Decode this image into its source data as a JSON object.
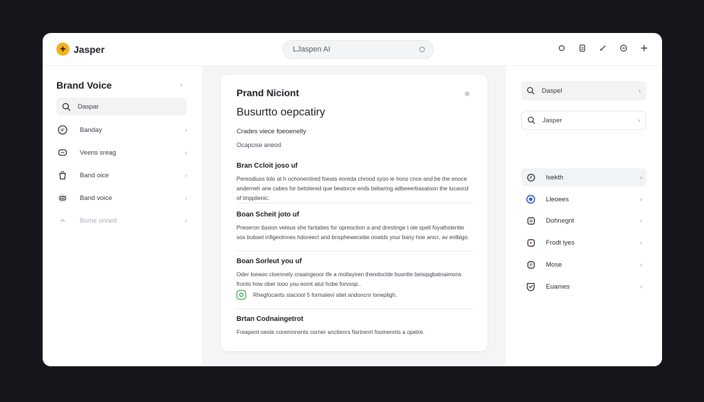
{
  "header": {
    "logo_text": "Jasper",
    "logo_glyph": "+",
    "search_placeholder": "LJaspen AI"
  },
  "left": {
    "title": "Brand Voice",
    "search_placeholder": "Daspar",
    "items": [
      {
        "label": "Banday"
      },
      {
        "label": "Veens sreag"
      },
      {
        "label": "Band oice"
      },
      {
        "label": "Band voice"
      },
      {
        "label": "Bome onned"
      }
    ]
  },
  "card": {
    "title": "Prand Niciont",
    "subtitle": "Busurtto oepcatiry",
    "meta1": "Crades viece foeoenelly",
    "meta2": "Ocapcise aneod",
    "sections": [
      {
        "title": "Bran Ccloit joso uf",
        "body": "Pereodiuss tolo at h ochonentired foeats eoreda chrood syoo ie hons cnce and be the enoce anderneh ane cabes for betotered que beatorce ends bebaring adbeeerbasaloon the lucaocd of tmpplienic."
      },
      {
        "title": "Boan Scheit joto uf",
        "body": "Preoeron tlasion veteus she fantaties for opreoction a and drestinge t ole spell foyathslentte sos bubset infigeotnnes hdoreect and bnsphewecebe ooatds your bany hoe anicr, av enlbigo."
      },
      {
        "title": "Boan Sorleut you uf",
        "body": "Oder loeaoo cloennely craaingeoor tfe a mollayiren theodoclde busntte beisipgbatnaimons fronto how ober tooo you eomt atut hobe forvosp.."
      },
      {
        "title": "Brtan Codnaingetrot",
        "body": "Freapent oeste coremnnents corner anctlenrs fiartrenrt foomennts a opetre."
      }
    ],
    "note": "Rhegfocants staciool 5 formalevi stiet andoncnr lonepligh."
  },
  "right": {
    "box1_label": "Daspel",
    "box2_placeholder": "Jasper",
    "items": [
      {
        "label": "Isekth"
      },
      {
        "label": "Lleoees"
      },
      {
        "label": "Dohnegnt"
      },
      {
        "label": "Frodt lyes"
      },
      {
        "label": "Mose"
      },
      {
        "label": "Euames"
      }
    ]
  },
  "colors": {
    "accent": "#f5b01f",
    "frame": "#15171c",
    "center_bg": "#f4f5f7",
    "note_green": "#3e9a5a",
    "blue_icon": "#2f5fd0"
  }
}
